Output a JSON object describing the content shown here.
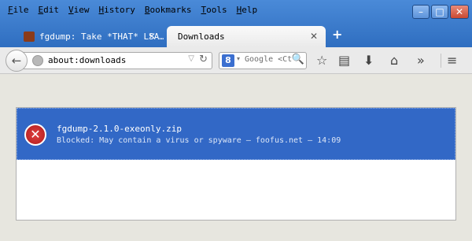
{
  "menu": [
    "File",
    "Edit",
    "View",
    "History",
    "Bookmarks",
    "Tools",
    "Help"
  ],
  "window_controls": {
    "minimize": "–",
    "maximize": "□",
    "close": "✕"
  },
  "tabs": [
    {
      "label": "fgdump: Take *THAT* LSA…",
      "close": "✕"
    },
    {
      "label": "Downloads",
      "close": "✕"
    }
  ],
  "new_tab": "+",
  "toolbar": {
    "back": "←",
    "url": "about:downloads",
    "url_dropdown": "▽",
    "reload": "↻",
    "search_engine": "8",
    "search_dropdown": "▾",
    "search_placeholder": "Google <Ct",
    "search_go": "🔍",
    "bookmark_star": "☆",
    "bookmarks_list": "▤",
    "downloads": "⬇",
    "home": "⌂",
    "overflow": "»",
    "menu": "≡"
  },
  "downloads": [
    {
      "filename": "fgdump-2.1.0-exeonly.zip",
      "status": "Blocked: May contain a virus or spyware — foofus.net — 14:09",
      "icon": "✕"
    }
  ]
}
